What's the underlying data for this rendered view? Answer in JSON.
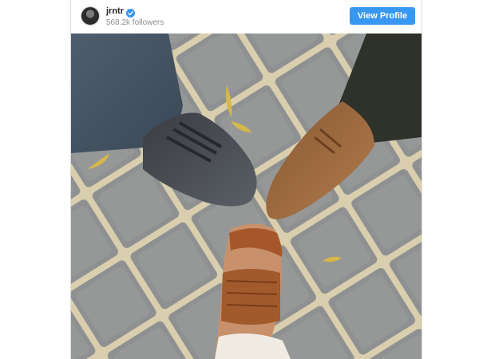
{
  "post": {
    "username": "jrntr",
    "followers": "568.2k followers",
    "view_profile_label": "View Profile"
  },
  "colors": {
    "accent": "#3897f0",
    "verified": "#3897f0"
  },
  "icons": {
    "verified": "verified-badge-icon",
    "avatar": "profile-avatar"
  }
}
